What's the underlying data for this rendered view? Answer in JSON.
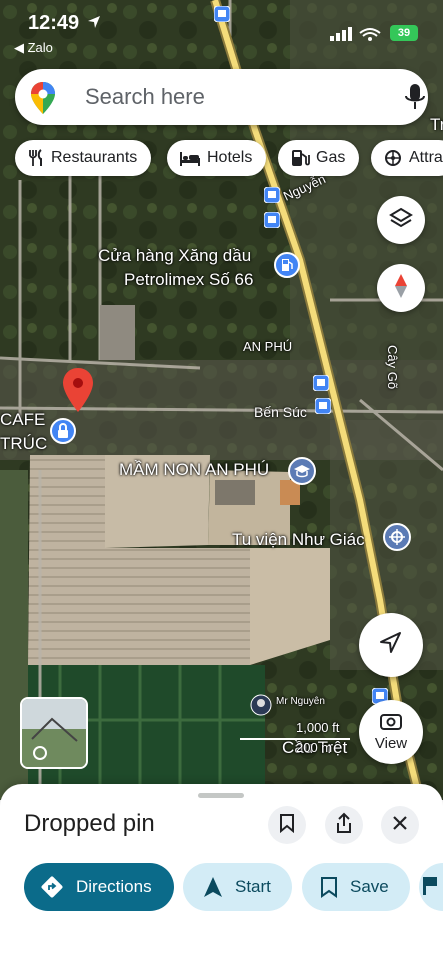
{
  "status_bar": {
    "time": "12:49",
    "back_app": "Zalo",
    "battery": "39"
  },
  "search": {
    "placeholder": "Search here",
    "logo_icon": "maps-pin-icon",
    "mic_icon": "microphone-icon"
  },
  "chips": [
    {
      "label": "Restaurants",
      "icon": "fork-knife-icon"
    },
    {
      "label": "Hotels",
      "icon": "bed-icon"
    },
    {
      "label": "Gas",
      "icon": "gas-pump-icon"
    },
    {
      "label": "Attra",
      "icon": "attraction-icon"
    }
  ],
  "map": {
    "labels": {
      "petrolimex_line1": "Cửa hàng Xăng dầu",
      "petrolimex_line2": "Petrolimex Số 66",
      "an_phu": "AN PHÚ",
      "ben_suc": "Bến Súc",
      "cay_go": "Cây Gõ",
      "nguyen": "Nguyễn",
      "cafe_line1": "CAFE",
      "cafe_line2": "TRÚC",
      "mam_non": "MẦM NON AN PHÚ",
      "tu_vien": "Tu viện Như Giác",
      "road_tr": "Tr",
      "cau_tret": "Cầu Trệt",
      "avatar_name": "Mr Nguyên"
    },
    "scale": {
      "ft": "1,000 ft",
      "m": "200 m"
    },
    "view_label": "View",
    "colors": {
      "pin": "#ea4335",
      "road": "#f4dc7a",
      "poi_blue": "#4285f4"
    }
  },
  "sheet": {
    "title": "Dropped pin",
    "actions": [
      {
        "label": "Directions",
        "icon": "directions-icon"
      },
      {
        "label": "Start",
        "icon": "navigation-arrow-icon"
      },
      {
        "label": "Save",
        "icon": "bookmark-icon"
      }
    ]
  }
}
